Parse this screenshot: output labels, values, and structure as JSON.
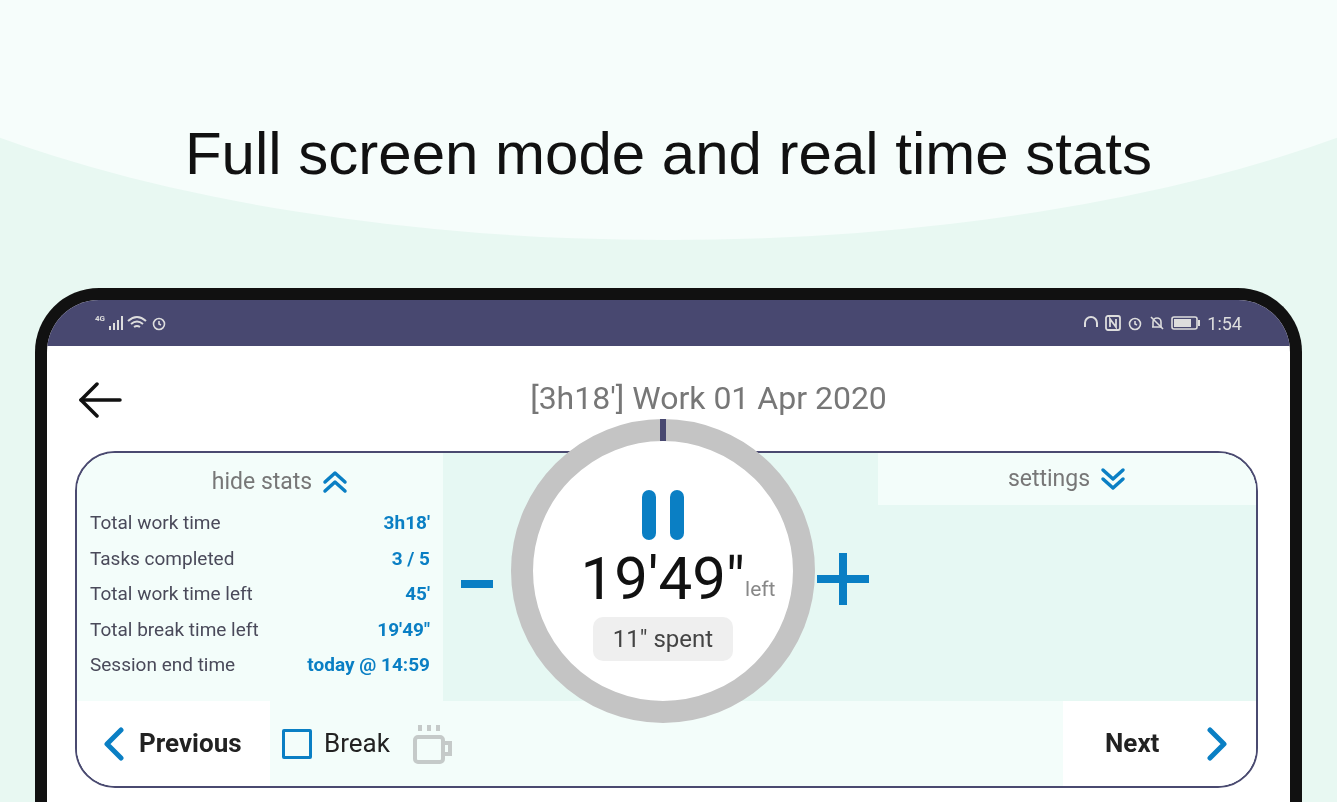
{
  "caption": "Full screen mode and real time stats",
  "status_bar": {
    "network": "4G",
    "time": "1:54"
  },
  "header": {
    "title": "[3h18'] Work 01 Apr 2020"
  },
  "stats": {
    "toggle": "hide stats",
    "expanded": true,
    "rows": [
      {
        "label": "Total work time",
        "value": "3h18'"
      },
      {
        "label": "Tasks completed",
        "value": "3 / 5"
      },
      {
        "label": "Total work time left",
        "value": "45'"
      },
      {
        "label": "Total break time left",
        "value": "19'49\""
      },
      {
        "label": "Session end time",
        "value": "today @ 14:59"
      }
    ]
  },
  "settings": {
    "label": "settings",
    "expanded": false
  },
  "timer": {
    "remaining": "19'49\"",
    "unit": "left",
    "spent": "11\" spent",
    "paused": false
  },
  "footer": {
    "previous": "Previous",
    "break": {
      "label": "Break",
      "checked": false
    },
    "next": "Next"
  }
}
